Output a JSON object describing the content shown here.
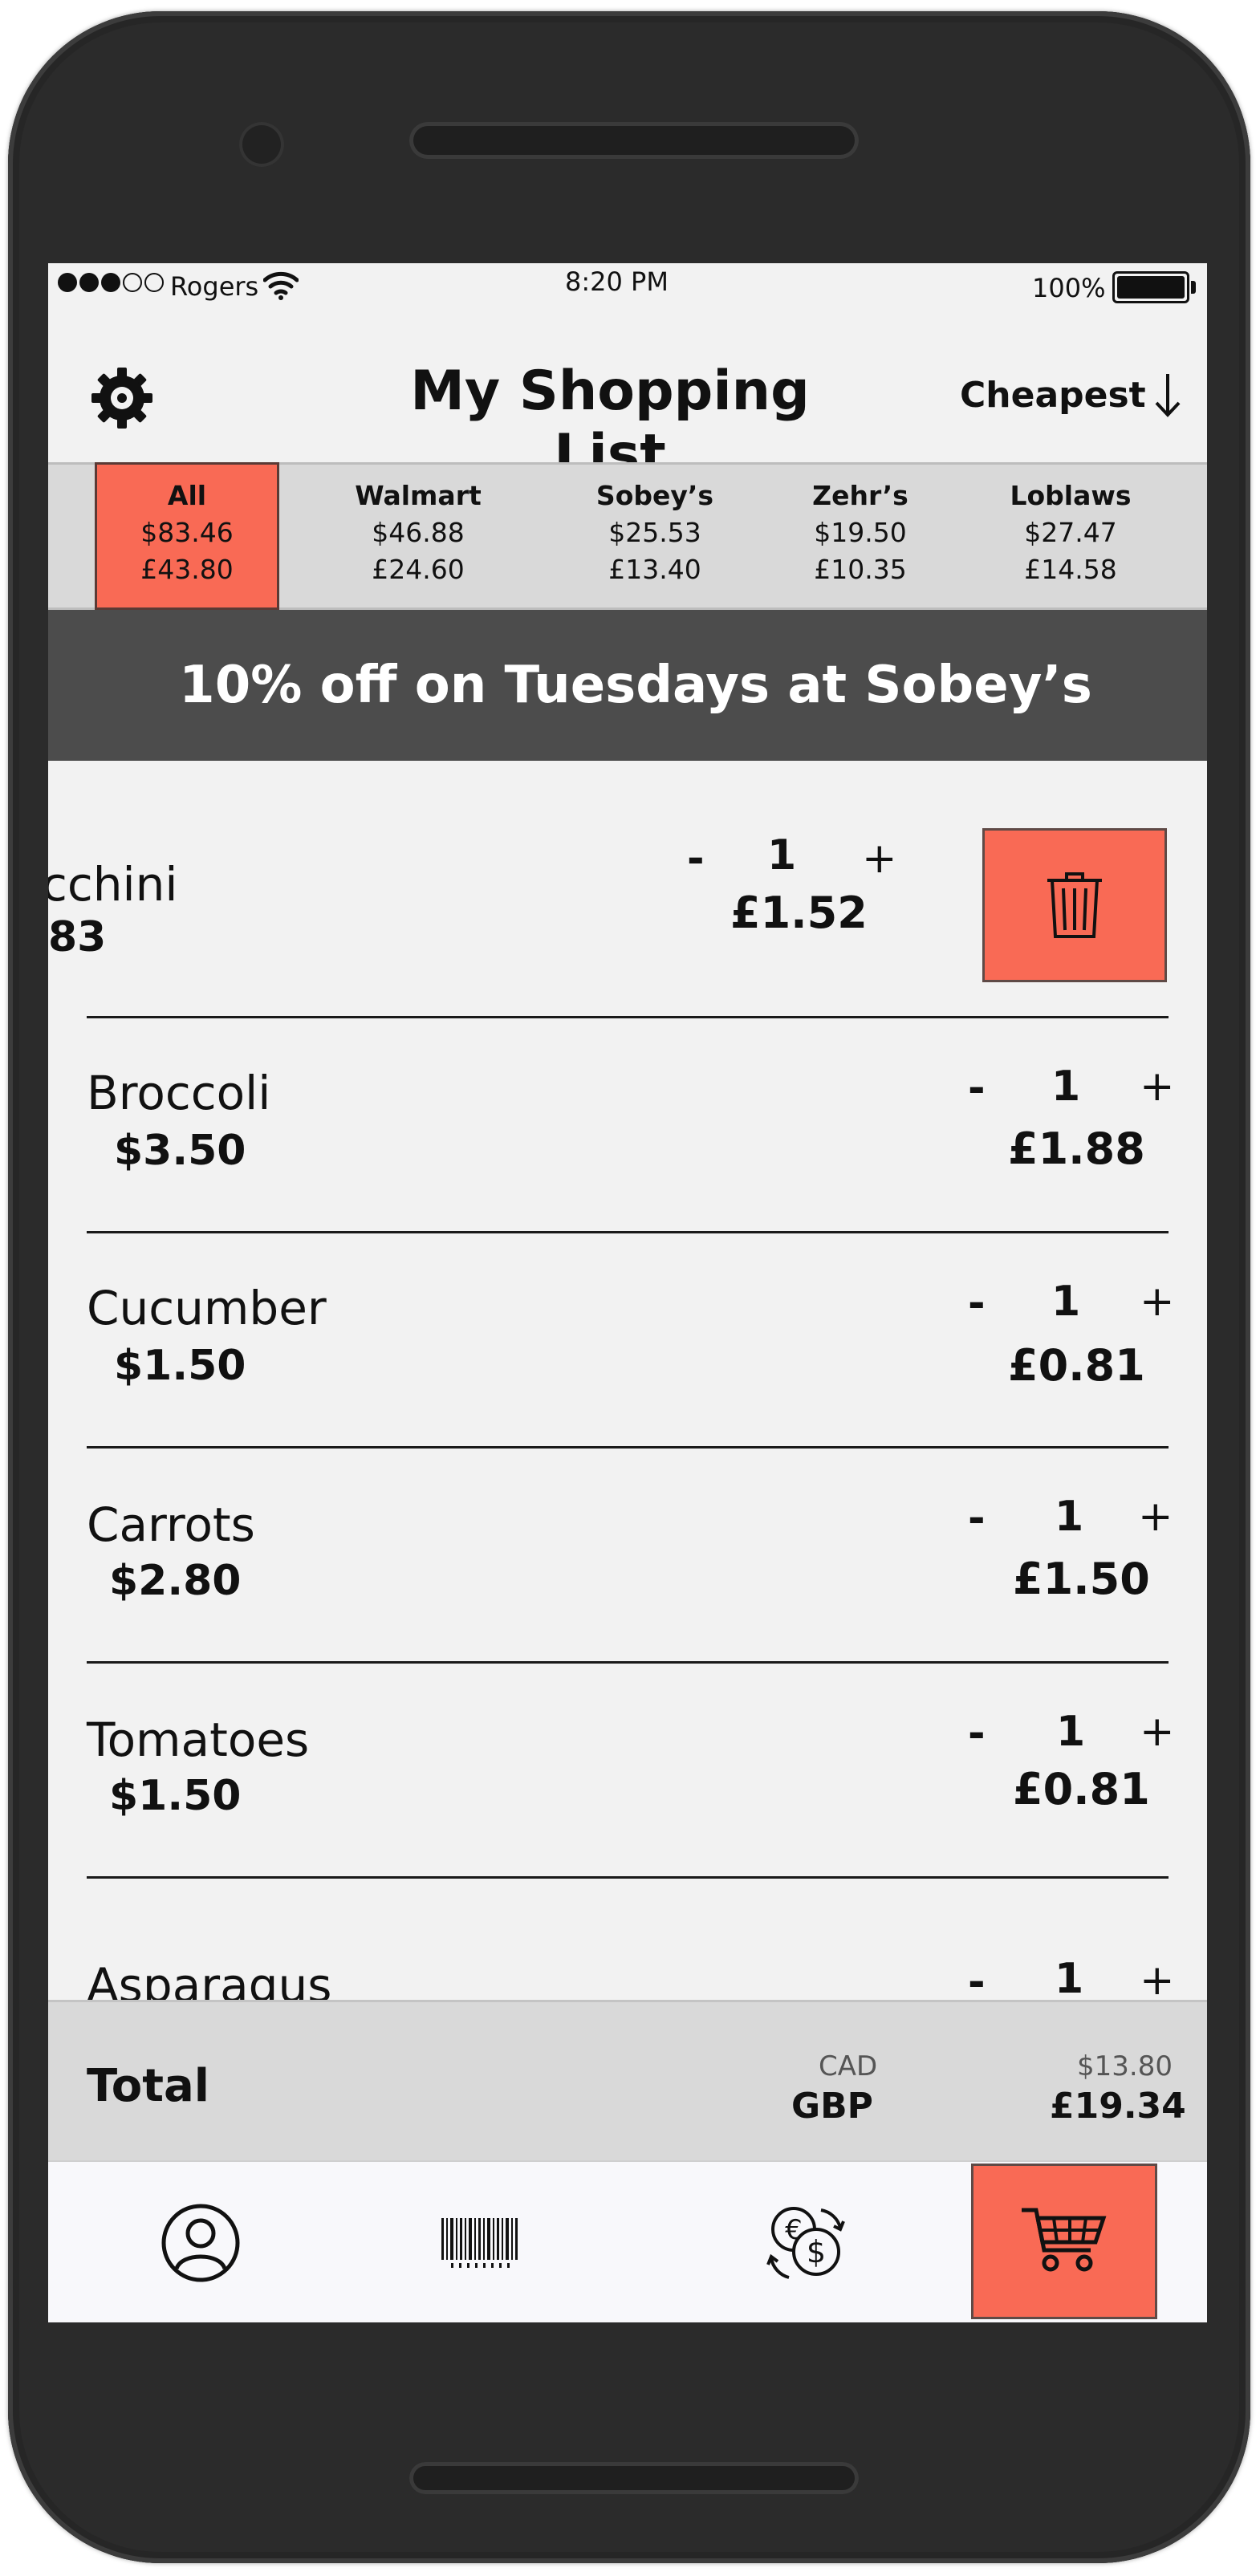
{
  "status_bar": {
    "carrier": "Rogers",
    "time": "8:20 PM",
    "battery_percent": "100%",
    "signal_bars": 3,
    "signal_max": 5
  },
  "header": {
    "title": "My Shopping List",
    "sort_label": "Cheapest",
    "icons": {
      "settings": "gear-icon",
      "sort": "arrow-down-icon"
    }
  },
  "stores": [
    {
      "name": "All",
      "cad": "$83.46",
      "gbp": "£43.80",
      "active": true
    },
    {
      "name": "Walmart",
      "cad": "$46.88",
      "gbp": "£24.60",
      "active": false
    },
    {
      "name": "Sobey’s",
      "cad": "$25.53",
      "gbp": "£13.40",
      "active": false
    },
    {
      "name": "Zehr’s",
      "cad": "$19.50",
      "gbp": "£10.35",
      "active": false
    },
    {
      "name": "Loblaws",
      "cad": "$27.47",
      "gbp": "£14.58",
      "active": false
    }
  ],
  "promo": "10% off on Tuesdays at Sobey’s",
  "items": [
    {
      "name": "cchini",
      "price": "83",
      "qty": "1",
      "gbp": "£1.52",
      "swiped": true
    },
    {
      "name": "Broccoli",
      "price": "$3.50",
      "qty": "1",
      "gbp": "£1.88"
    },
    {
      "name": "Cucumber",
      "price": "$1.50",
      "qty": "1",
      "gbp": "£0.81"
    },
    {
      "name": "Carrots",
      "price": "$2.80",
      "qty": "1",
      "gbp": "£1.50"
    },
    {
      "name": "Tomatoes",
      "price": "$1.50",
      "qty": "1",
      "gbp": "£0.81"
    },
    {
      "name": "Asparagus",
      "price": "",
      "qty": "1",
      "gbp": ""
    }
  ],
  "stepper": {
    "minus": "-",
    "plus": "+"
  },
  "delete_icon": "trash-icon",
  "total": {
    "label": "Total",
    "cad_label": "CAD",
    "gbp_label": "GBP",
    "cad_value": "$13.80",
    "gbp_value": "£19.34"
  },
  "bottom_nav": [
    {
      "icon": "profile-icon",
      "active": false
    },
    {
      "icon": "barcode-icon",
      "active": false
    },
    {
      "icon": "currency-exchange-icon",
      "active": false
    },
    {
      "icon": "cart-icon",
      "active": true
    }
  ],
  "colors": {
    "accent": "#f96a55",
    "promo_bg": "#4c4c4c",
    "tab_bar_bg": "#d9d9d9",
    "screen_bg": "#f2f2f2",
    "frame": "#2b2b2b"
  }
}
